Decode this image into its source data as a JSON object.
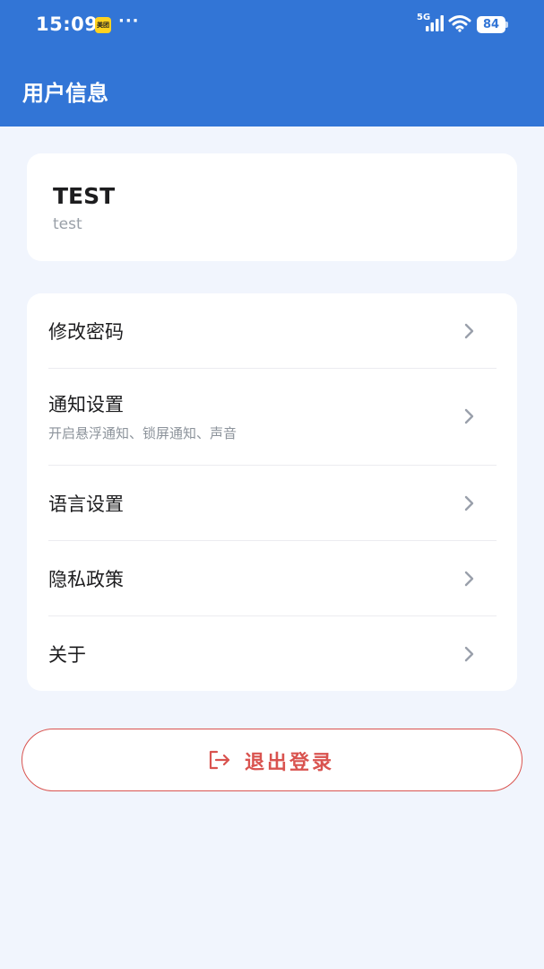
{
  "status_bar": {
    "time": "15:09",
    "app_badge": "美团",
    "more": "···",
    "network": "5G",
    "battery": "84"
  },
  "header": {
    "title": "用户信息"
  },
  "user": {
    "name": "TEST",
    "id": "test"
  },
  "menu": {
    "items": [
      {
        "label": "修改密码",
        "sub": ""
      },
      {
        "label": "通知设置",
        "sub": "开启悬浮通知、锁屏通知、声音"
      },
      {
        "label": "语言设置",
        "sub": ""
      },
      {
        "label": "隐私政策",
        "sub": ""
      },
      {
        "label": "关于",
        "sub": ""
      }
    ]
  },
  "logout": {
    "label": "退出登录"
  },
  "colors": {
    "header_bg": "#3275d6",
    "page_bg": "#f1f5fd",
    "danger": "#d9534f",
    "chevron": "#9aa0ab"
  },
  "icons": {
    "chevron": "chevron-right-icon",
    "logout": "logout-icon",
    "signal": "signal-icon",
    "wifi": "wifi-icon"
  }
}
